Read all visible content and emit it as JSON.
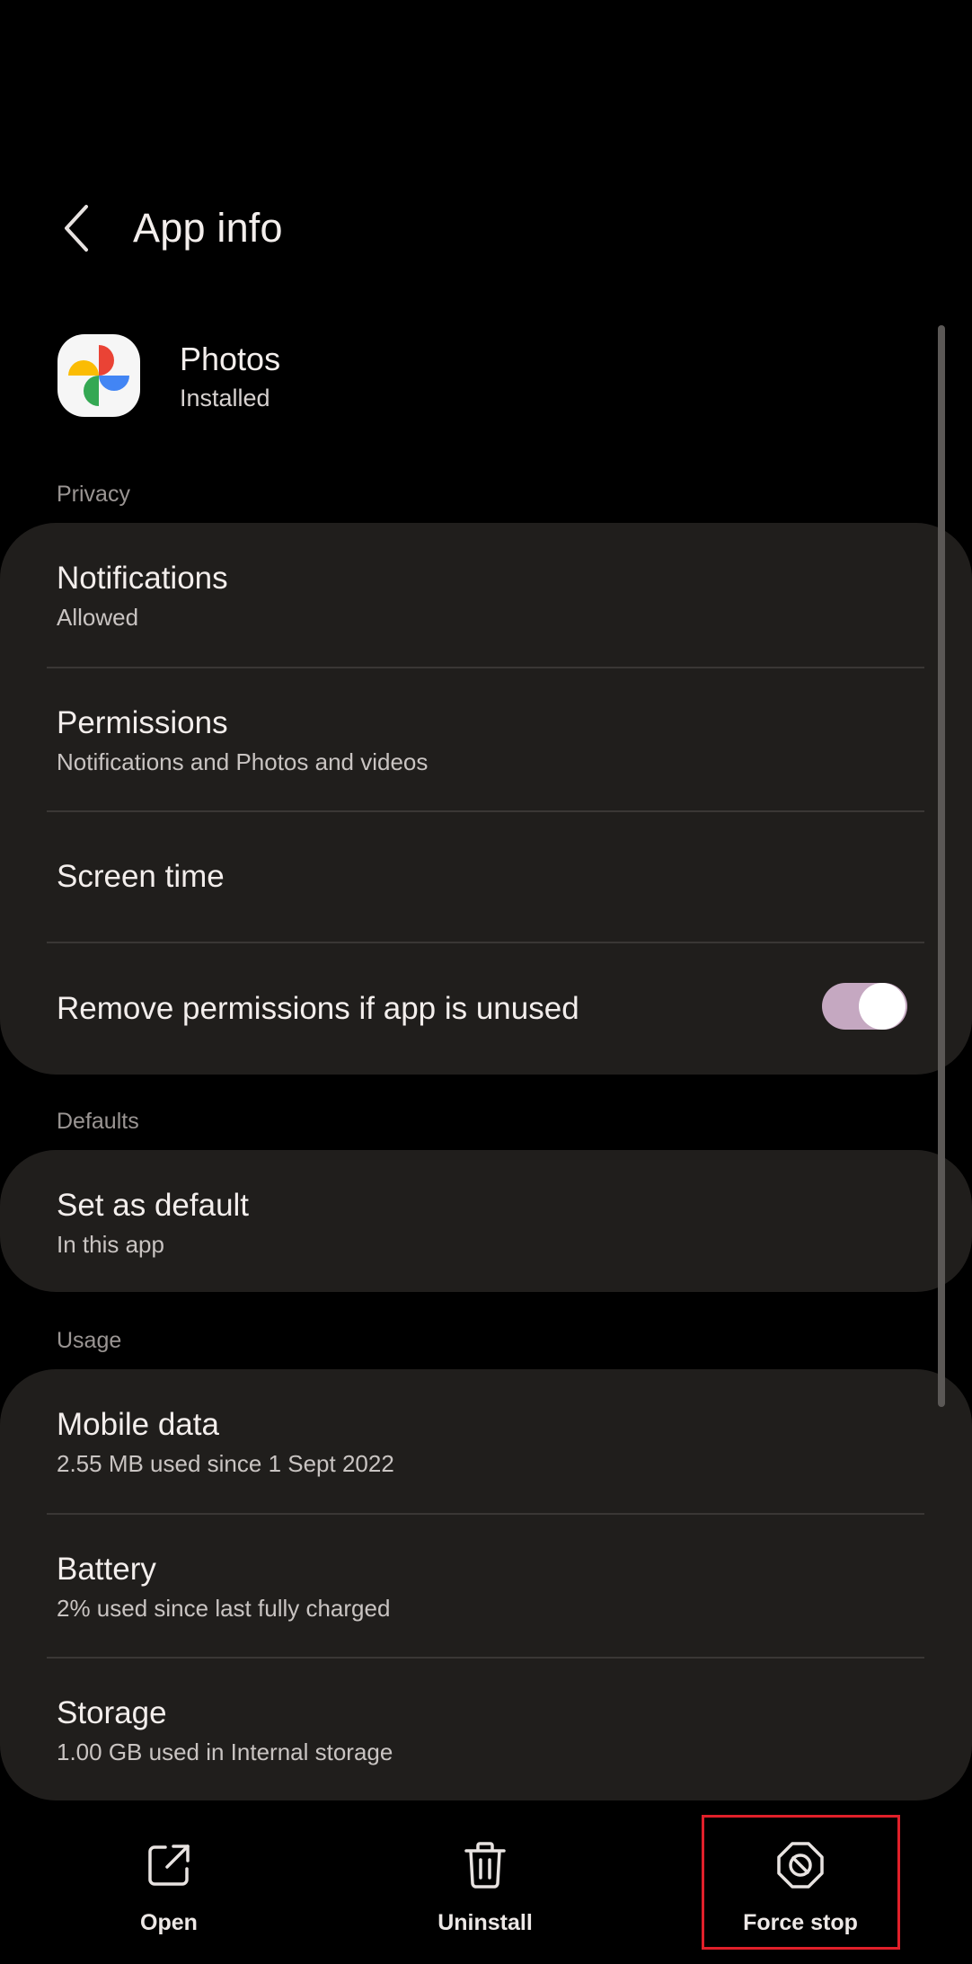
{
  "header": {
    "title": "App info"
  },
  "app": {
    "name": "Photos",
    "status": "Installed"
  },
  "sections": {
    "privacy": {
      "label": "Privacy",
      "items": [
        {
          "title": "Notifications",
          "subtitle": "Allowed"
        },
        {
          "title": "Permissions",
          "subtitle": "Notifications and Photos and videos"
        },
        {
          "title": "Screen time"
        },
        {
          "title": "Remove permissions if app is unused",
          "toggle_on": true
        }
      ]
    },
    "defaults": {
      "label": "Defaults",
      "items": [
        {
          "title": "Set as default",
          "subtitle": "In this app"
        }
      ]
    },
    "usage": {
      "label": "Usage",
      "items": [
        {
          "title": "Mobile data",
          "subtitle": "2.55 MB used since 1 Sept 2022"
        },
        {
          "title": "Battery",
          "subtitle": "2% used since last fully charged"
        },
        {
          "title": "Storage",
          "subtitle": "1.00 GB used in Internal storage"
        }
      ]
    }
  },
  "actions": [
    {
      "label": "Open",
      "icon": "open-external-icon"
    },
    {
      "label": "Uninstall",
      "icon": "trash-icon"
    },
    {
      "label": "Force stop",
      "icon": "stop-icon"
    }
  ],
  "colors": {
    "background": "#000000",
    "card": "#201E1C",
    "toggle": "#C5A8C1",
    "highlight": "#E0202A"
  }
}
